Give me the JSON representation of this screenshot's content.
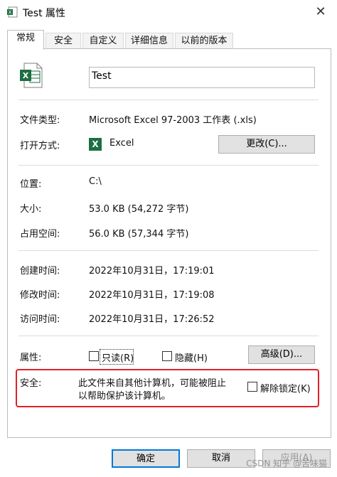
{
  "window": {
    "title": "Test 属性",
    "close": "✕"
  },
  "tabs": [
    "常规",
    "安全",
    "自定义",
    "详细信息",
    "以前的版本"
  ],
  "file": {
    "name": "Test"
  },
  "props": {
    "type_label": "文件类型:",
    "type_value": "Microsoft Excel 97-2003 工作表 (.xls)",
    "open_label": "打开方式:",
    "open_app": "Excel",
    "change_button": "更改(C)...",
    "location_label": "位置:",
    "location_value": "C:\\",
    "size_label": "大小:",
    "size_value": "53.0 KB (54,272 字节)",
    "disk_label": "占用空间:",
    "disk_value": "56.0 KB (57,344 字节)",
    "created_label": "创建时间:",
    "created_value": "2022年10月31日，17:19:01",
    "modified_label": "修改时间:",
    "modified_value": "2022年10月31日，17:19:08",
    "accessed_label": "访问时间:",
    "accessed_value": "2022年10月31日，17:26:52",
    "attr_label": "属性:",
    "readonly_label": "只读(R)",
    "hidden_label": "隐藏(H)",
    "advanced_button": "高级(D)...",
    "security_label": "安全:",
    "security_text_1": "此文件来自其他计算机，可能被阻止",
    "security_text_2": "以帮助保护该计算机。",
    "unblock_label": "解除锁定(K)"
  },
  "buttons": {
    "ok": "确定",
    "cancel": "取消",
    "apply": "应用(A)"
  },
  "watermark": "CSDN 知乎 @苦味猫",
  "colors": {
    "excel_green": "#1d6f42",
    "alert_red": "#e0202a"
  }
}
